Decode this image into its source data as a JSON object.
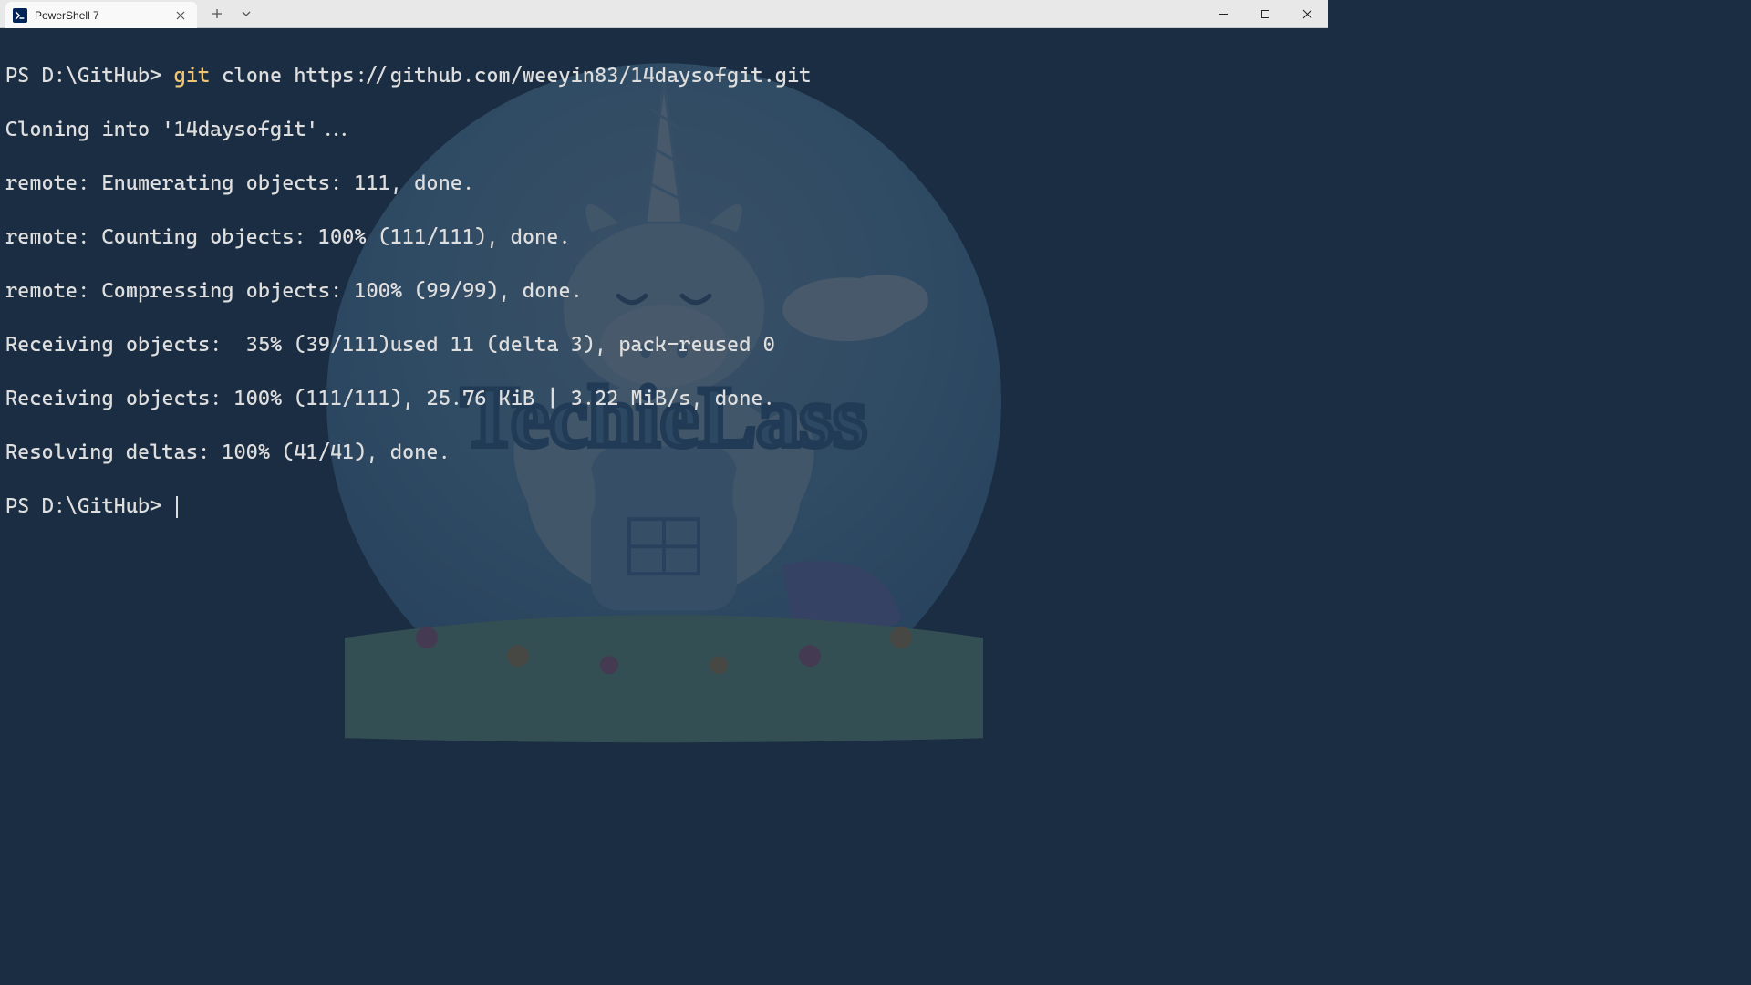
{
  "titlebar": {
    "tab_title": "PowerShell 7",
    "tab_icon_label": "PS"
  },
  "terminal": {
    "line1_prompt": "PS D:\\GitHub> ",
    "line1_git": "git",
    "line1_rest": " clone https://github.com/weeyin83/14daysofgit.git",
    "line2": "Cloning into '14daysofgit'...",
    "line3": "remote: Enumerating objects: 111, done.",
    "line4": "remote: Counting objects: 100% (111/111), done.",
    "line5": "remote: Compressing objects: 100% (99/99), done.",
    "line6": "Receiving objects:  35% (39/111)used 11 (delta 3), pack-reused 0",
    "line7": "Receiving objects: 100% (111/111), 25.76 KiB | 3.22 MiB/s, done.",
    "line8": "Resolving deltas: 100% (41/41), done.",
    "line9_prompt": "PS D:\\GitHub> "
  },
  "watermark": {
    "text": "TechieLass"
  }
}
